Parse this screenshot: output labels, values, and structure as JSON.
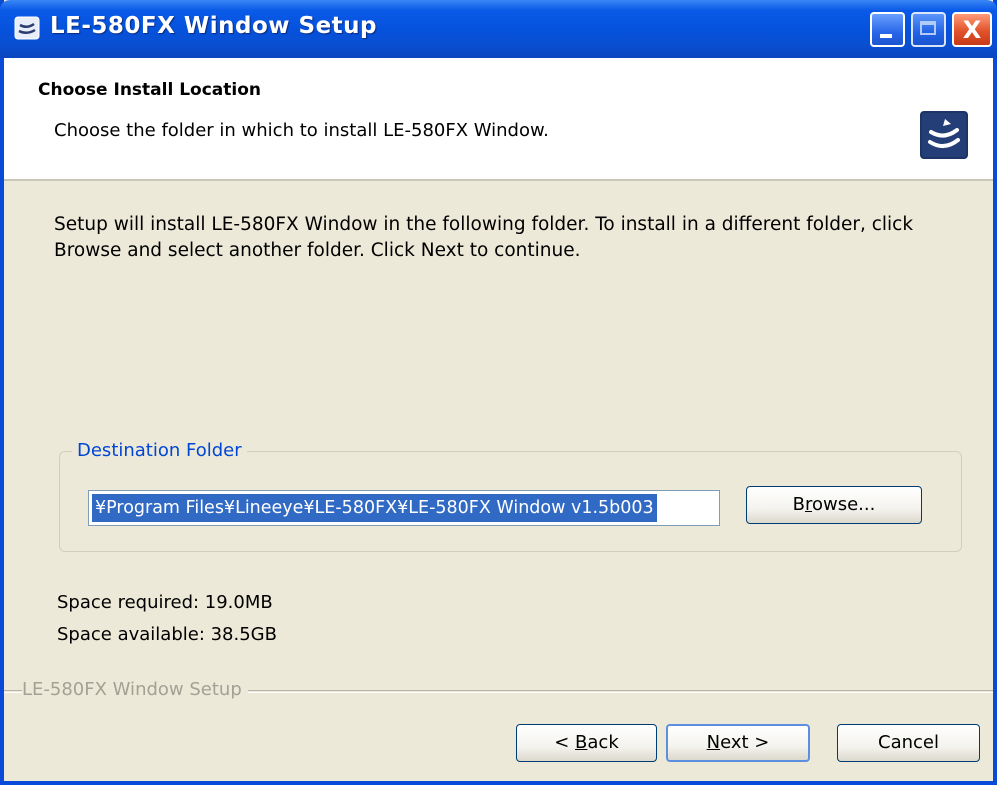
{
  "window": {
    "title": "LE-580FX Window Setup",
    "close_glyph": "X"
  },
  "header": {
    "title": "Choose Install Location",
    "subtitle": "Choose the folder in which to install LE-580FX Window.",
    "icon": "setup-logo-icon"
  },
  "body": {
    "instructions": "Setup will install LE-580FX Window in the following folder. To install in a different folder, click Browse and select another folder. Click Next to continue."
  },
  "destination": {
    "group_label": "Destination Folder",
    "path_value": "¥Program Files¥Lineeye¥LE-580FX¥LE-580FX Window v1.5b003",
    "browse_pre": "B",
    "browse_accel": "r",
    "browse_post": "owse..."
  },
  "space": {
    "required": "Space required: 19.0MB",
    "available": "Space available: 38.5GB"
  },
  "footer": {
    "brand": "LE-580FX Window Setup",
    "back_pre": "< ",
    "back_accel": "B",
    "back_post": "ack",
    "next_accel": "N",
    "next_post": "ext >",
    "cancel_label": "Cancel"
  },
  "colors": {
    "titlebar": "#0552dc",
    "dialog_bg": "#ece9d8",
    "selection": "#316ac5",
    "group_label": "#0046d5"
  }
}
